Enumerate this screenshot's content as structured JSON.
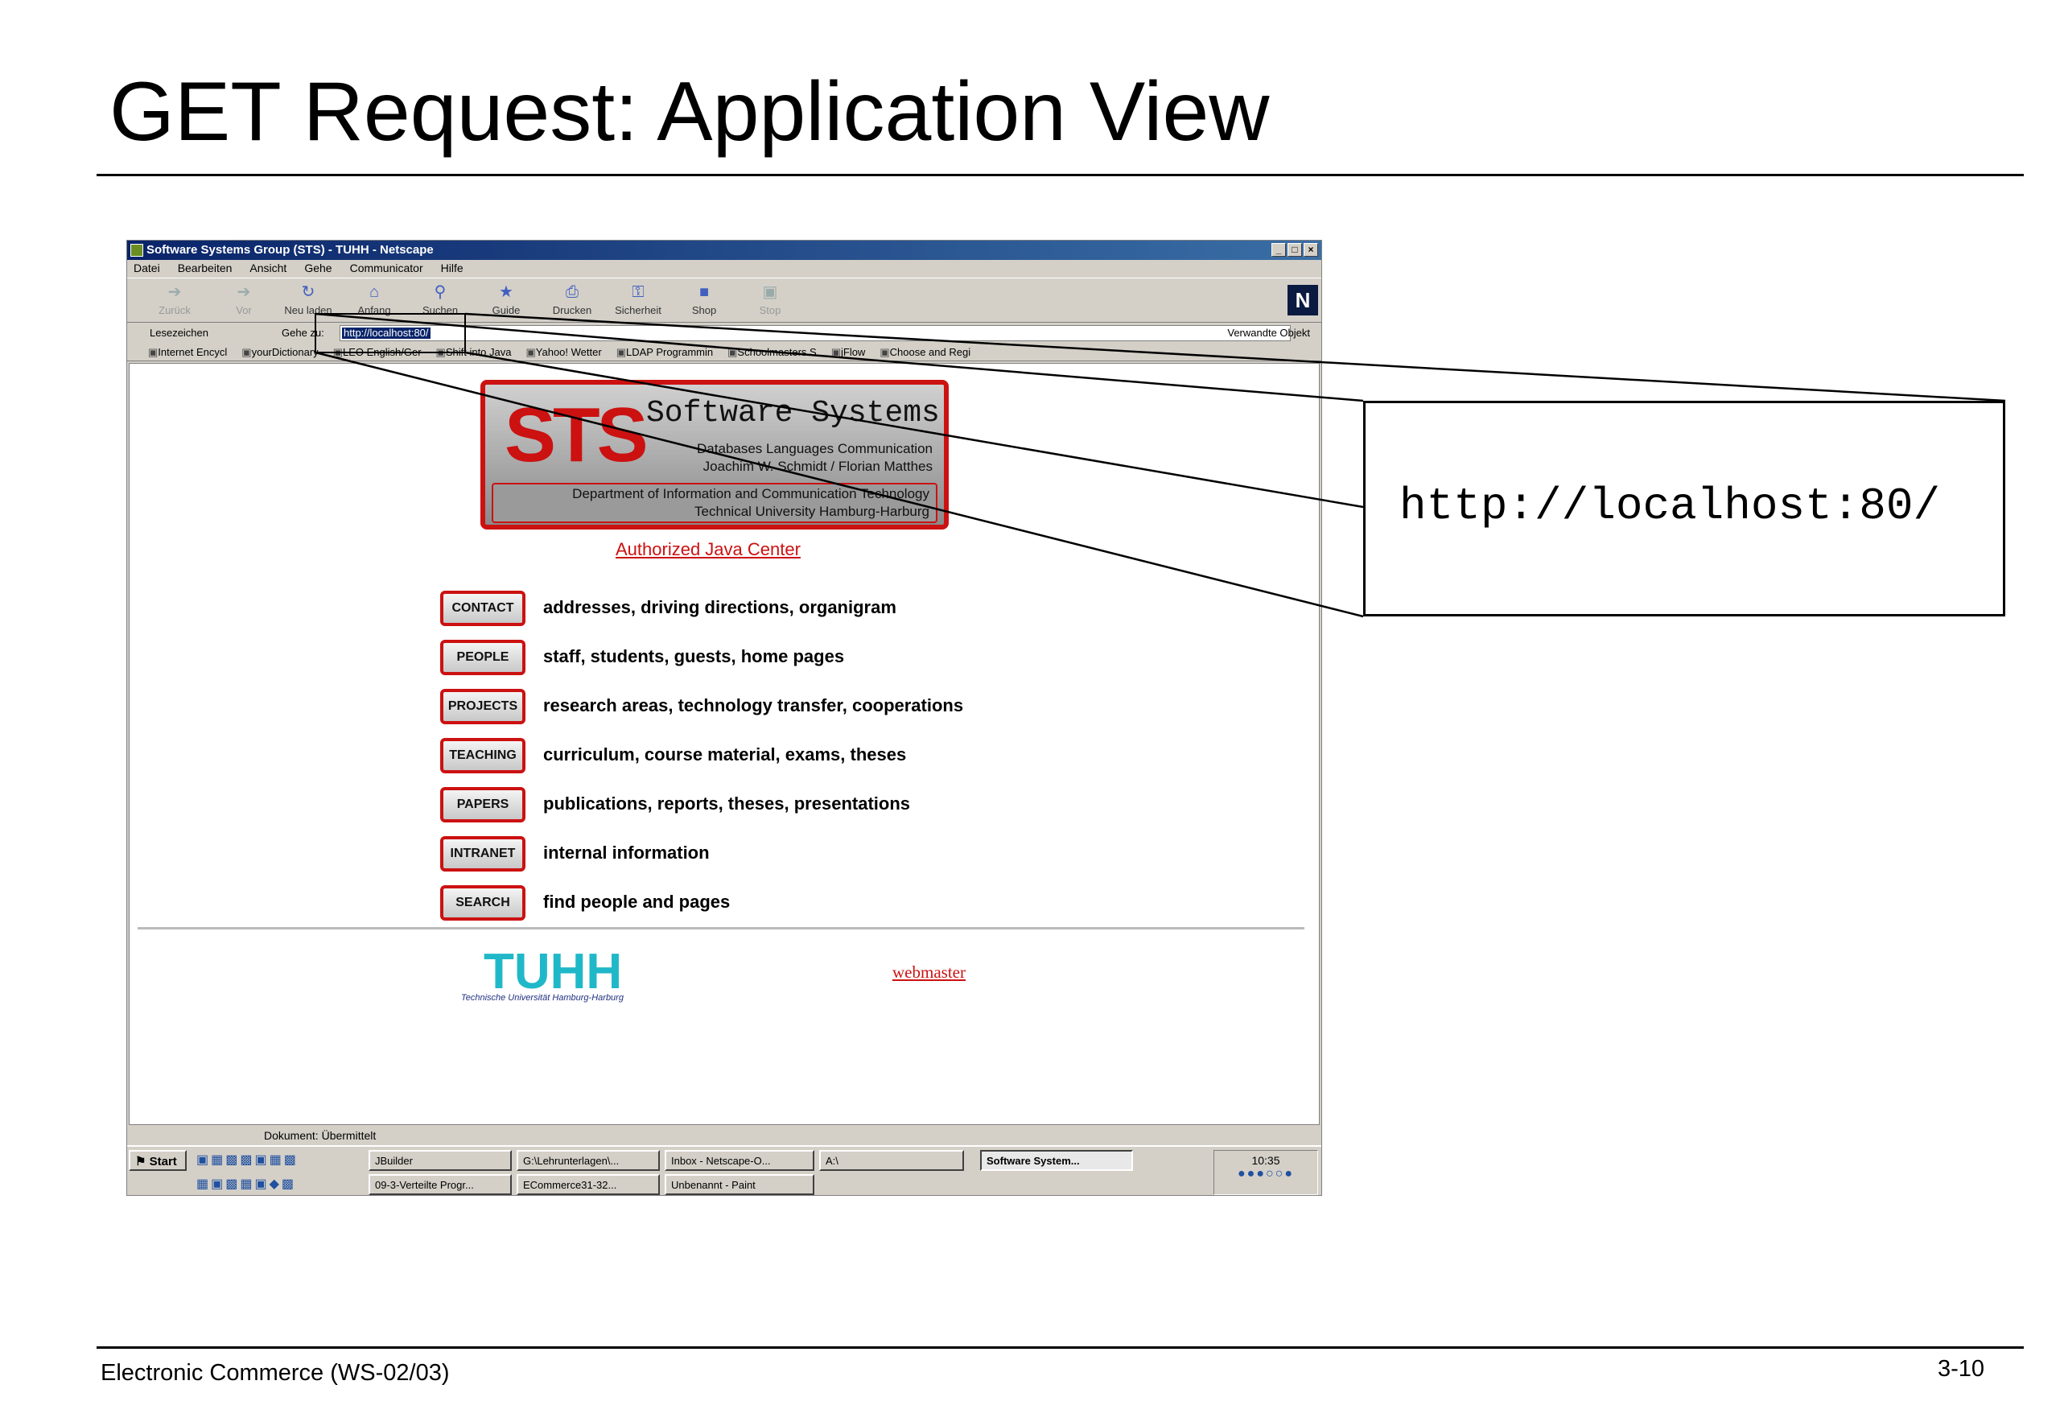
{
  "slide": {
    "title": "GET Request: Application View",
    "footer_left": "Electronic Commerce (WS-02/03)",
    "footer_right": "3-10",
    "callout_url": "http://localhost:80/"
  },
  "browser": {
    "window_title": "Software Systems Group (STS) - TUHH - Netscape",
    "menu": [
      "Datei",
      "Bearbeiten",
      "Ansicht",
      "Gehe",
      "Communicator",
      "Hilfe"
    ],
    "toolbar": [
      {
        "label": "Zurück",
        "icon": "back-arrow-icon",
        "enabled": false
      },
      {
        "label": "Vor",
        "icon": "forward-arrow-icon",
        "enabled": false
      },
      {
        "label": "Neu laden",
        "icon": "reload-icon",
        "enabled": true
      },
      {
        "label": "Anfang",
        "icon": "home-icon",
        "enabled": true
      },
      {
        "label": "Suchen",
        "icon": "search-icon",
        "enabled": true
      },
      {
        "label": "Guide",
        "icon": "guide-icon",
        "enabled": true
      },
      {
        "label": "Drucken",
        "icon": "print-icon",
        "enabled": true
      },
      {
        "label": "Sicherheit",
        "icon": "lock-icon",
        "enabled": true
      },
      {
        "label": "Shop",
        "icon": "shop-icon",
        "enabled": true
      },
      {
        "label": "Stop",
        "icon": "stop-icon",
        "enabled": false
      }
    ],
    "location": {
      "bookmarks_label": "Lesezeichen",
      "goto_label": "Gehe zu:",
      "url": "http://localhost:80/",
      "related_label": "Verwandte Objekt"
    },
    "personal_bar": [
      "Internet Encycl",
      "yourDictionary",
      "LEO English/Ger",
      "Shift into Java",
      "Yahoo! Wetter",
      "LDAP Programmin",
      "Schoolmasters S",
      "jFlow",
      "Choose and Regi"
    ],
    "status_text": "Dokument: Übermittelt"
  },
  "page": {
    "logo": {
      "big": "STS",
      "name": "Software Systems",
      "line1": "Databases Languages Communication",
      "line2": "Joachim W. Schmidt / Florian Matthes",
      "line3": "Department of Information and Communication Technology",
      "line4": "Technical University Hamburg-Harburg"
    },
    "ajc_link": "Authorized Java Center",
    "nav": [
      {
        "button": "CONTACT",
        "desc": "addresses, driving directions, organigram"
      },
      {
        "button": "PEOPLE",
        "desc": "staff, students, guests, home pages"
      },
      {
        "button": "PROJECTS",
        "desc": "research areas, technology transfer, cooperations"
      },
      {
        "button": "TEACHING",
        "desc": "curriculum, course material, exams, theses"
      },
      {
        "button": "PAPERS",
        "desc": "publications, reports, theses, presentations"
      },
      {
        "button": "INTRANET",
        "desc": "internal information"
      },
      {
        "button": "SEARCH",
        "desc": "find people and pages"
      }
    ],
    "tuhh_logo": "TUHH",
    "tuhh_sub": "Technische Universität Hamburg-Harburg",
    "webmaster": "webmaster"
  },
  "taskbar": {
    "start": "Start",
    "tasks_row1": [
      "JBuilder",
      "G:\\Lehrunterlagen\\...",
      "Inbox - Netscape-O...",
      "A:\\"
    ],
    "tasks_row2": [
      "09-3-Verteilte Progr...",
      "ECommerce31-32...",
      "Unbenannt - Paint"
    ],
    "active_task": "Software System...",
    "clock": "10:35"
  },
  "colors": {
    "accent_red": "#cc1111",
    "titlebar_blue": "#0a246a",
    "tuhh_cyan": "#20b8c8"
  }
}
